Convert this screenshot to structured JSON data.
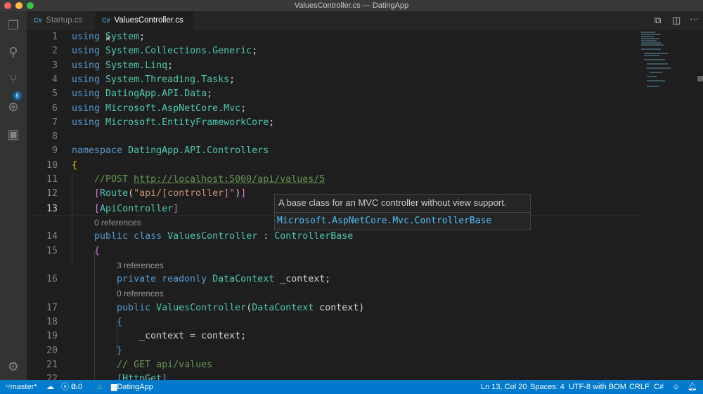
{
  "window": {
    "title": "ValuesController.cs — DatingApp"
  },
  "tabs": [
    {
      "icon": "C#",
      "label": "Startup.cs",
      "active": false
    },
    {
      "icon": "C#",
      "label": "ValuesController.cs",
      "active": true,
      "close": "×"
    }
  ],
  "activity_bar": {
    "scm_badge": "8"
  },
  "editor": {
    "rows": [
      {
        "n": "1",
        "t": [
          [
            "k",
            "using "
          ],
          [
            "t",
            "System"
          ],
          [
            "p",
            ";"
          ]
        ]
      },
      {
        "n": "2",
        "t": [
          [
            "k",
            "using "
          ],
          [
            "t",
            "System.Collections.Generic"
          ],
          [
            "p",
            ";"
          ]
        ]
      },
      {
        "n": "3",
        "t": [
          [
            "k",
            "using "
          ],
          [
            "t",
            "System.Linq"
          ],
          [
            "p",
            ";"
          ]
        ]
      },
      {
        "n": "4",
        "t": [
          [
            "k",
            "using "
          ],
          [
            "t",
            "System.Threading.Tasks"
          ],
          [
            "p",
            ";"
          ]
        ]
      },
      {
        "n": "5",
        "t": [
          [
            "k",
            "using "
          ],
          [
            "t",
            "DatingApp.API.Data"
          ],
          [
            "p",
            ";"
          ]
        ]
      },
      {
        "n": "6",
        "t": [
          [
            "k",
            "using "
          ],
          [
            "t",
            "Microsoft.AspNetCore.Mvc"
          ],
          [
            "p",
            ";"
          ]
        ]
      },
      {
        "n": "7",
        "t": [
          [
            "k",
            "using "
          ],
          [
            "t",
            "Microsoft.EntityFrameworkCore"
          ],
          [
            "p",
            ";"
          ]
        ]
      },
      {
        "n": "8",
        "t": []
      },
      {
        "n": "9",
        "t": [
          [
            "k",
            "namespace "
          ],
          [
            "t",
            "DatingApp.API.Controllers"
          ]
        ]
      },
      {
        "n": "10",
        "t": [
          [
            "y",
            "{"
          ]
        ]
      },
      {
        "n": "11",
        "t": [
          [
            "p",
            "    "
          ],
          [
            "c",
            "//POST "
          ],
          [
            "u",
            "http://localhost:5000/api/values/5"
          ]
        ]
      },
      {
        "n": "12",
        "t": [
          [
            "p",
            "    "
          ],
          [
            "m",
            "["
          ],
          [
            "t",
            "Route"
          ],
          [
            "p",
            "("
          ],
          [
            "s",
            "\"api/[controller]\""
          ],
          [
            "p",
            ")"
          ],
          [
            "m",
            "]"
          ]
        ]
      },
      {
        "n": "13",
        "t": [
          [
            "p",
            "    "
          ],
          [
            "m",
            "["
          ],
          [
            "t",
            "ApiController"
          ],
          [
            "m",
            "]"
          ]
        ]
      },
      {
        "lens": "0 references",
        "indent": 4
      },
      {
        "n": "14",
        "t": [
          [
            "p",
            "    "
          ],
          [
            "k",
            "public class "
          ],
          [
            "t",
            "ValuesController"
          ],
          [
            "p",
            " : "
          ],
          [
            "t",
            "ControllerBase"
          ]
        ]
      },
      {
        "n": "15",
        "t": [
          [
            "p",
            "    "
          ],
          [
            "m",
            "{"
          ]
        ]
      },
      {
        "lens": "3 references",
        "indent": 8
      },
      {
        "n": "16",
        "t": [
          [
            "p",
            "        "
          ],
          [
            "k",
            "private readonly "
          ],
          [
            "t",
            "DataContext"
          ],
          [
            "p",
            " _context;"
          ]
        ]
      },
      {
        "lens": "0 references",
        "indent": 8
      },
      {
        "n": "17",
        "t": [
          [
            "p",
            "        "
          ],
          [
            "k",
            "public "
          ],
          [
            "t",
            "ValuesController"
          ],
          [
            "p",
            "("
          ],
          [
            "t",
            "DataContext"
          ],
          [
            "p",
            " context)"
          ]
        ]
      },
      {
        "n": "18",
        "t": [
          [
            "p",
            "        "
          ],
          [
            "k",
            "{"
          ]
        ]
      },
      {
        "n": "19",
        "t": [
          [
            "p",
            "            _context = context;"
          ]
        ]
      },
      {
        "n": "20",
        "t": [
          [
            "p",
            "        "
          ],
          [
            "k",
            "}"
          ]
        ]
      },
      {
        "n": "21",
        "t": [
          [
            "p",
            "        "
          ],
          [
            "c",
            "// GET api/values"
          ]
        ]
      },
      {
        "n": "22",
        "t": [
          [
            "p",
            "        "
          ],
          [
            "k",
            "["
          ],
          [
            "t",
            "HttpGet"
          ],
          [
            "k",
            "]"
          ]
        ]
      }
    ],
    "active_line": "13"
  },
  "hover": {
    "description": "A base class for an MVC controller without view support.",
    "signature": "Microsoft.AspNetCore.Mvc.ControllerBase"
  },
  "status": {
    "branch": "master*",
    "errors": "0",
    "warnings": "0",
    "folder": "DatingApp",
    "position": "Ln 13, Col 20",
    "spaces": "Spaces: 4",
    "encoding": "UTF-8 with BOM",
    "eol": "CRLF",
    "language": "C#"
  },
  "colors": {
    "status_bar": "#007acc",
    "editor_bg": "#1e1e1e",
    "keyword": "#569cd6",
    "type": "#4ec9b0",
    "string": "#ce9178",
    "comment": "#6a9955"
  }
}
